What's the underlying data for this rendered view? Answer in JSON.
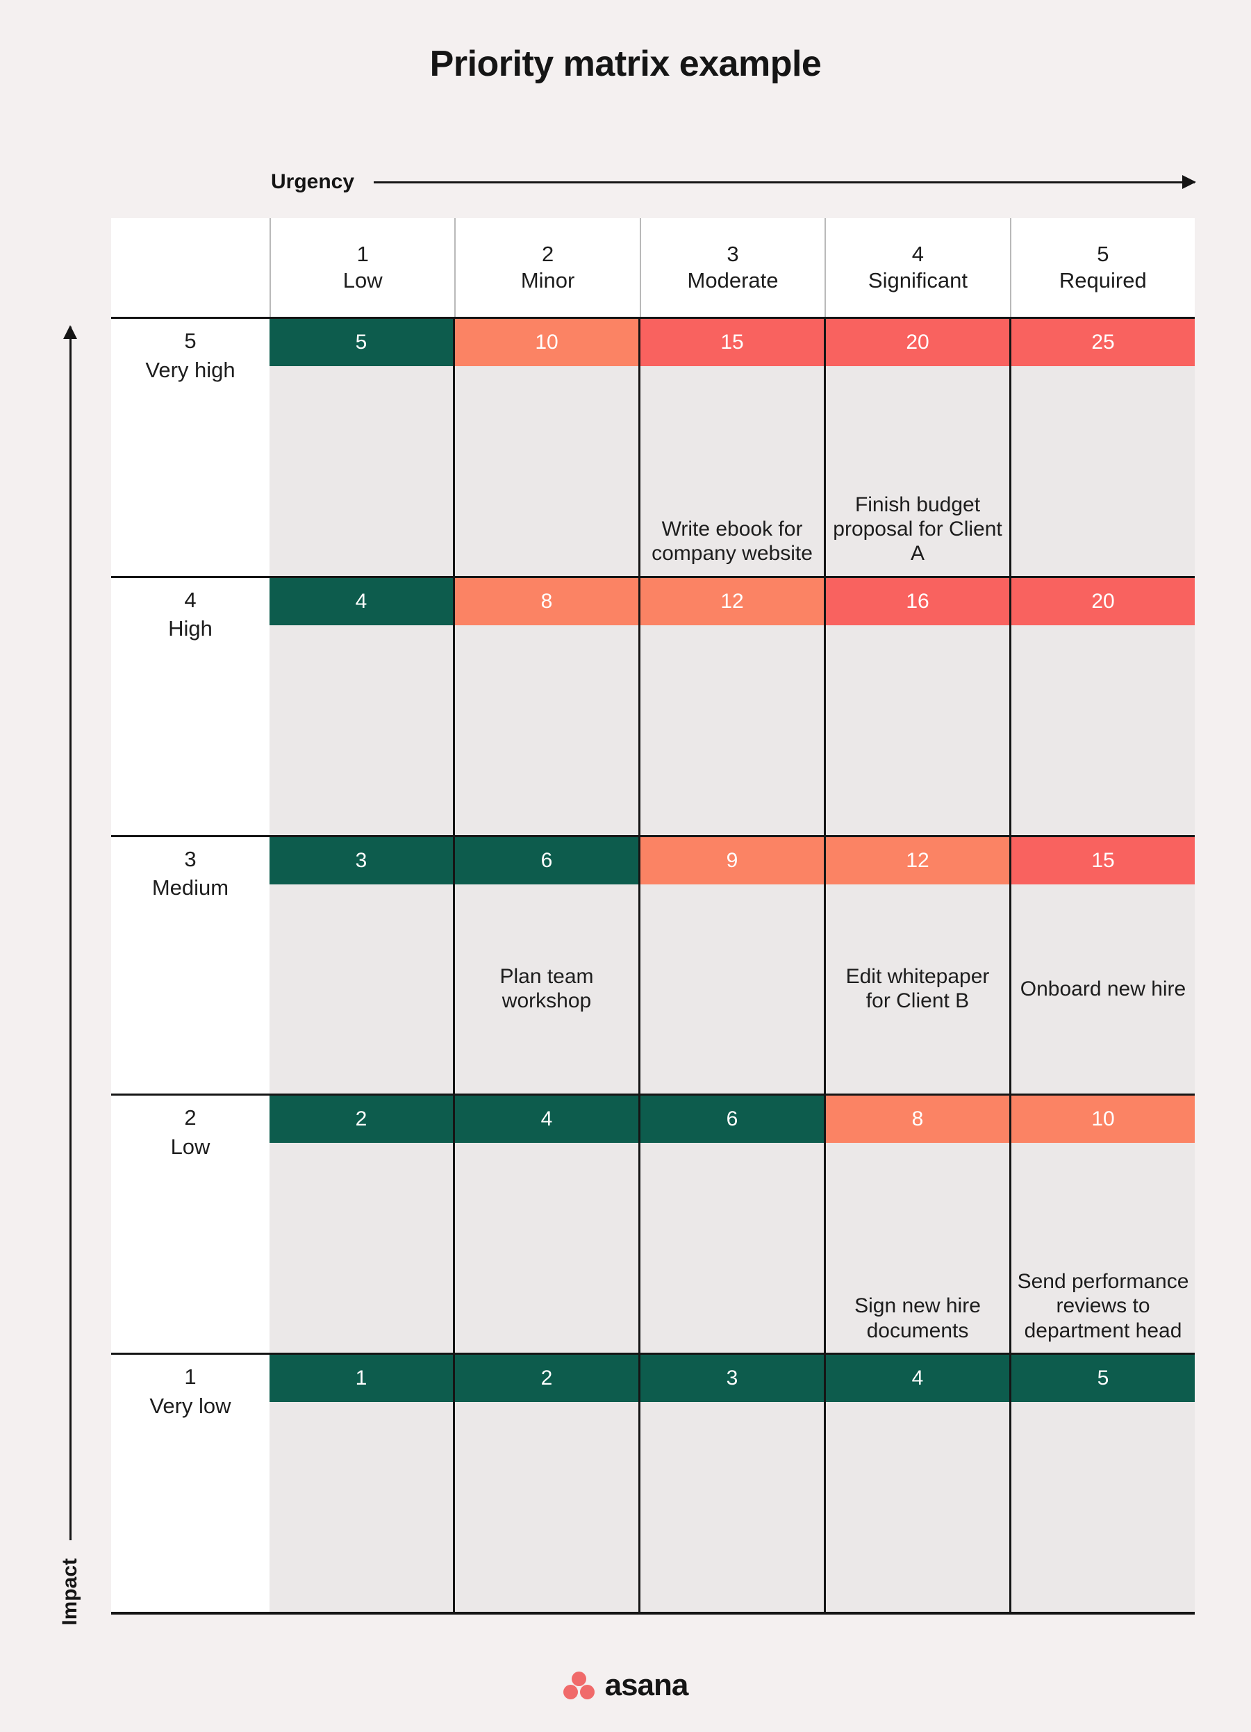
{
  "title": "Priority matrix example",
  "axes": {
    "x_label": "Urgency",
    "y_label": "Impact"
  },
  "colors": {
    "teal": "#0d5c4d",
    "salmon": "#fb8364",
    "red": "#f9625f",
    "background": "#f4f0f0",
    "cell_background": "#ebe8e8",
    "brand": "#f06a6a"
  },
  "brand": {
    "name": "asana"
  },
  "chart_data": {
    "type": "heatmap",
    "title": "Priority matrix example",
    "xlabel": "Urgency",
    "ylabel": "Impact",
    "columns": [
      {
        "num": "1",
        "label": "Low"
      },
      {
        "num": "2",
        "label": "Minor"
      },
      {
        "num": "3",
        "label": "Moderate"
      },
      {
        "num": "4",
        "label": "Significant"
      },
      {
        "num": "5",
        "label": "Required"
      }
    ],
    "rows": [
      {
        "num": "5",
        "label": "Very high",
        "cells": [
          {
            "score": "5",
            "color": "teal",
            "task": ""
          },
          {
            "score": "10",
            "color": "salmon",
            "task": ""
          },
          {
            "score": "15",
            "color": "red",
            "task": "Write ebook for company website"
          },
          {
            "score": "20",
            "color": "red",
            "task": "Finish budget proposal for Client A"
          },
          {
            "score": "25",
            "color": "red",
            "task": ""
          }
        ]
      },
      {
        "num": "4",
        "label": "High",
        "cells": [
          {
            "score": "4",
            "color": "teal",
            "task": ""
          },
          {
            "score": "8",
            "color": "salmon",
            "task": ""
          },
          {
            "score": "12",
            "color": "salmon",
            "task": ""
          },
          {
            "score": "16",
            "color": "red",
            "task": ""
          },
          {
            "score": "20",
            "color": "red",
            "task": ""
          }
        ]
      },
      {
        "num": "3",
        "label": "Medium",
        "cells": [
          {
            "score": "3",
            "color": "teal",
            "task": ""
          },
          {
            "score": "6",
            "color": "teal",
            "task": "Plan team workshop"
          },
          {
            "score": "9",
            "color": "salmon",
            "task": ""
          },
          {
            "score": "12",
            "color": "salmon",
            "task": "Edit whitepaper for Client B"
          },
          {
            "score": "15",
            "color": "red",
            "task": "Onboard new hire"
          }
        ]
      },
      {
        "num": "2",
        "label": "Low",
        "cells": [
          {
            "score": "2",
            "color": "teal",
            "task": ""
          },
          {
            "score": "4",
            "color": "teal",
            "task": ""
          },
          {
            "score": "6",
            "color": "teal",
            "task": ""
          },
          {
            "score": "8",
            "color": "salmon",
            "task": "Sign new hire documents"
          },
          {
            "score": "10",
            "color": "salmon",
            "task": "Send performance reviews to department head"
          }
        ]
      },
      {
        "num": "1",
        "label": "Very low",
        "cells": [
          {
            "score": "1",
            "color": "teal",
            "task": ""
          },
          {
            "score": "2",
            "color": "teal",
            "task": ""
          },
          {
            "score": "3",
            "color": "teal",
            "task": ""
          },
          {
            "score": "4",
            "color": "teal",
            "task": ""
          },
          {
            "score": "5",
            "color": "teal",
            "task": ""
          }
        ]
      }
    ]
  }
}
